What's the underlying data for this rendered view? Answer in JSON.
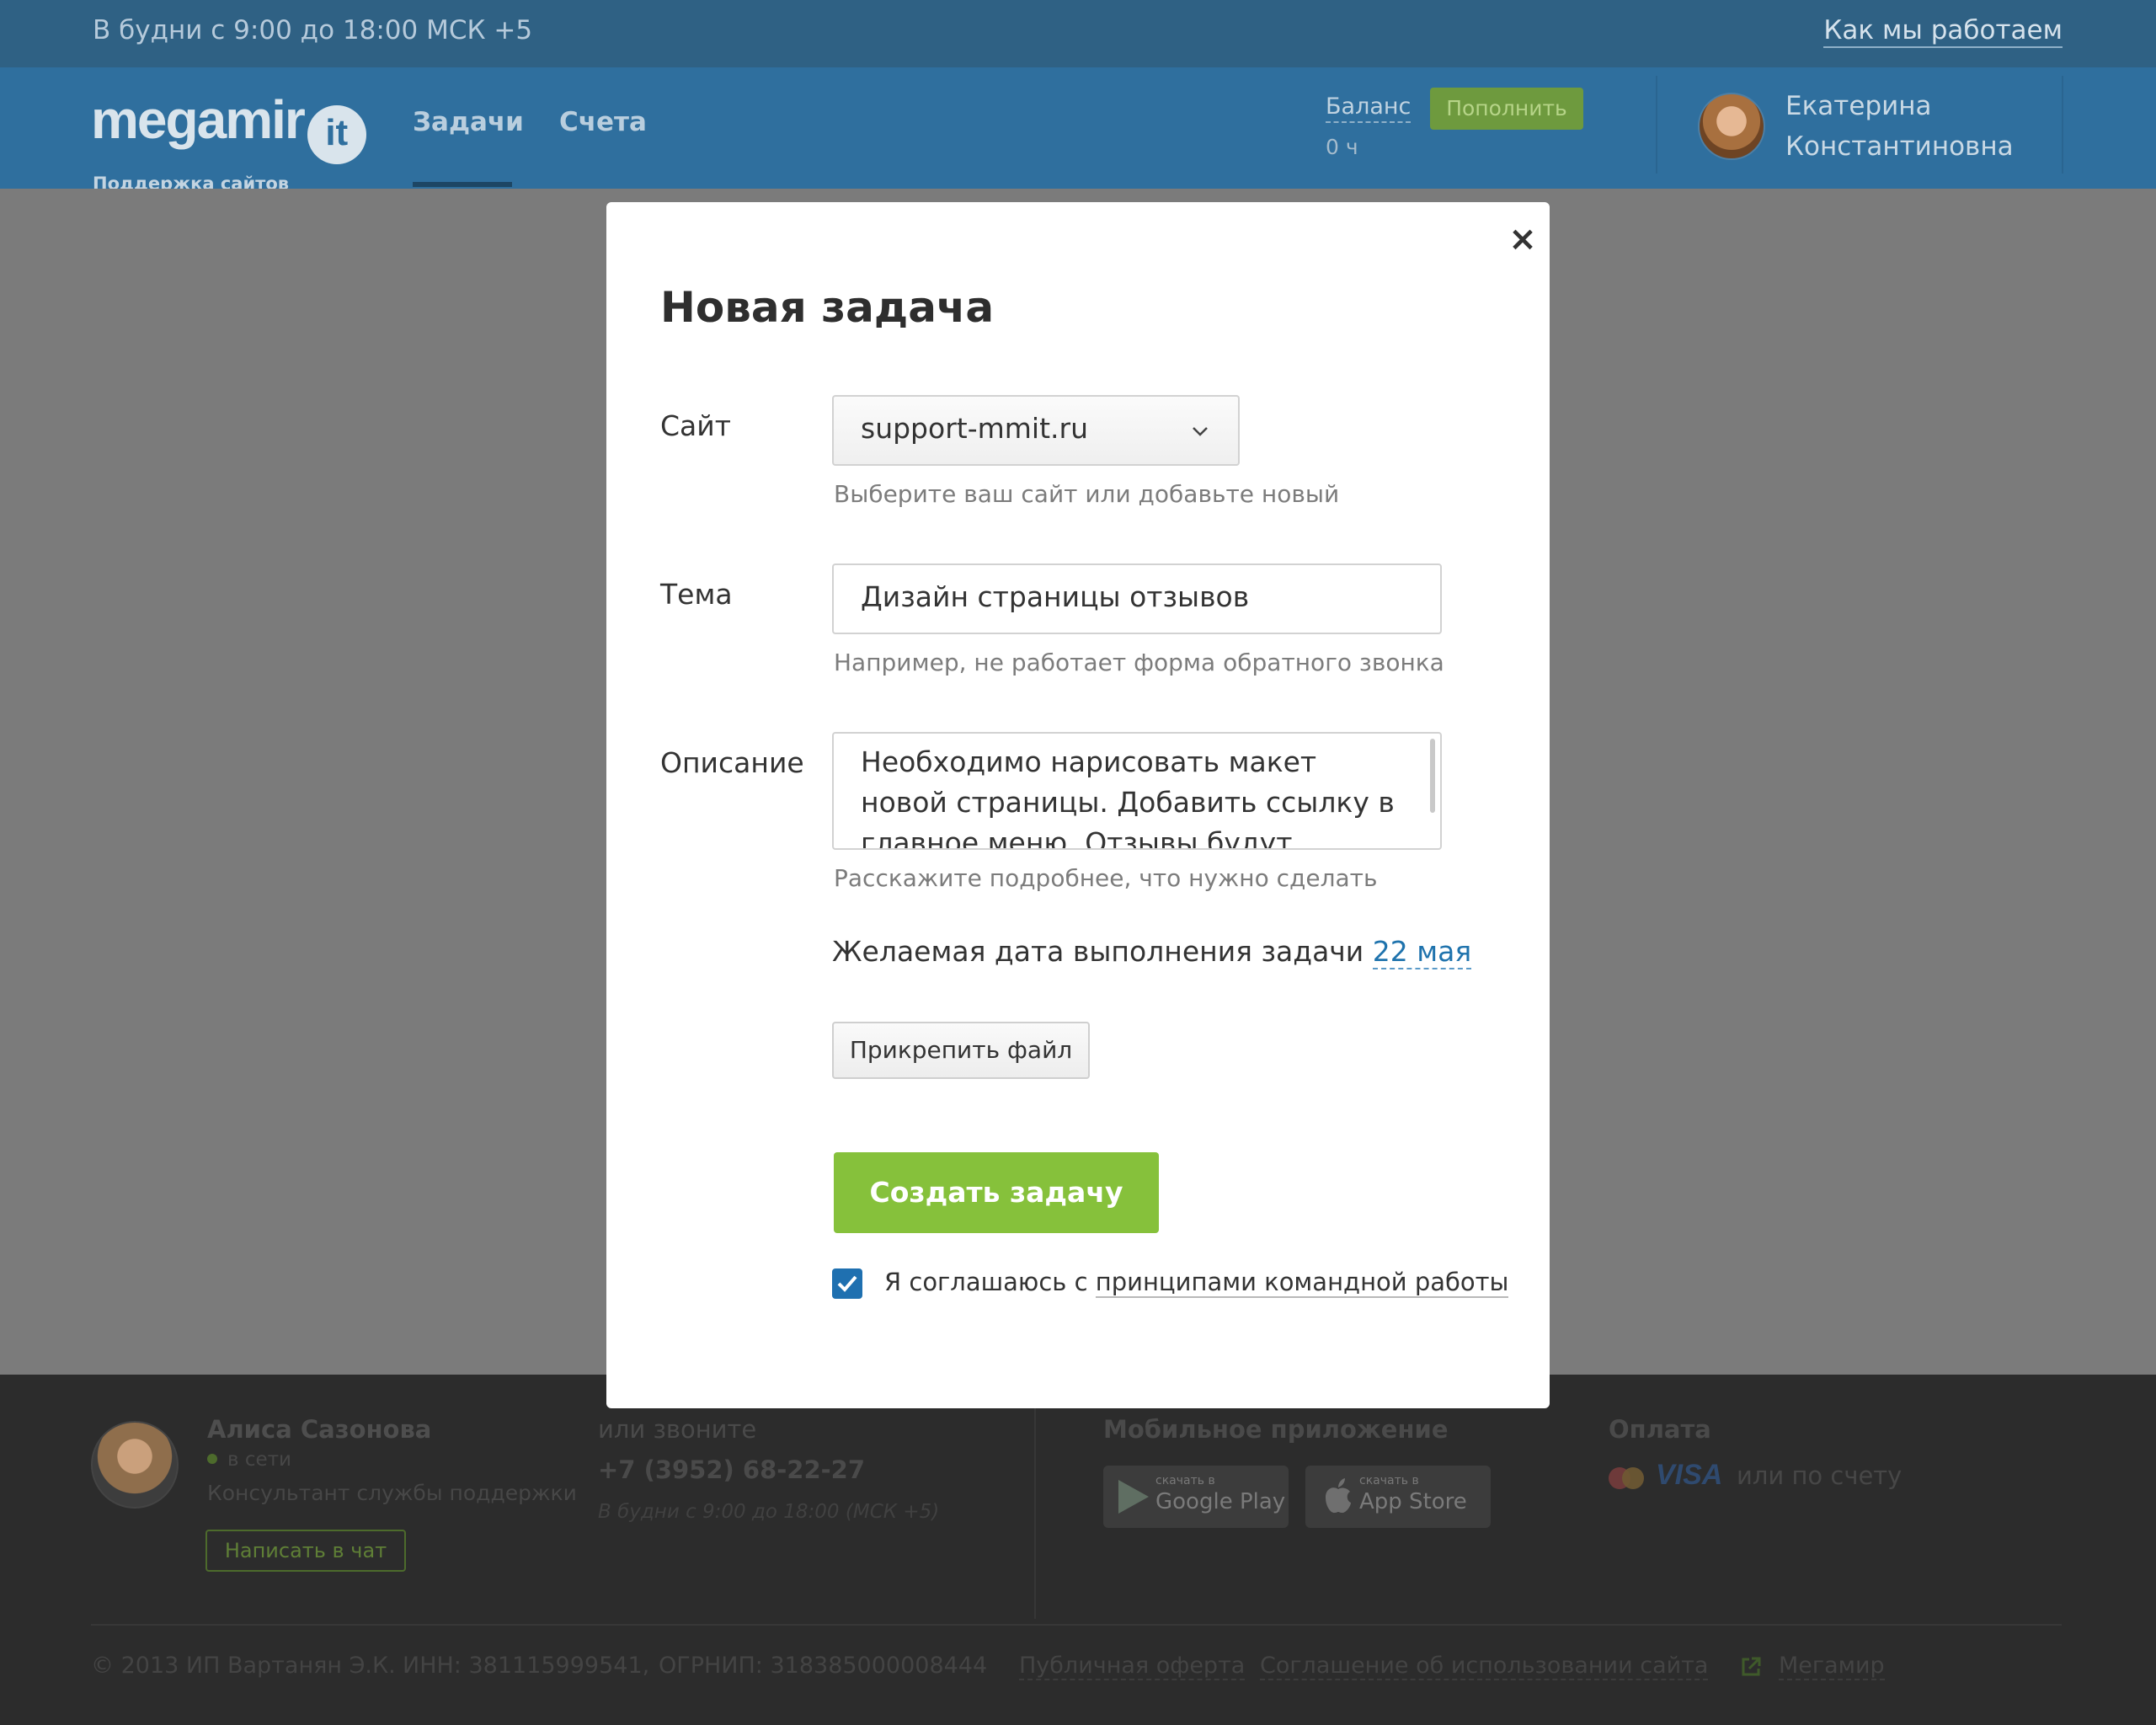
{
  "topbar": {
    "hours": "В будни с 9:00 до 18:00 МСК +5",
    "how_we_work": "Как мы работаем"
  },
  "header": {
    "logo_word": "megamir",
    "logo_it": "it",
    "logo_sub": "Поддержка сайтов",
    "nav": [
      {
        "label": "Задачи",
        "active": true
      },
      {
        "label": "Счета",
        "active": false
      }
    ],
    "balance_label": "Баланс",
    "topup_label": "Пополнить",
    "balance_value": "0 ч",
    "user_first_name": "Екатерина",
    "user_last_name": "Константиновна"
  },
  "modal": {
    "title": "Новая задача",
    "site": {
      "label": "Сайт",
      "value": "support-mmit.ru",
      "hint": "Выберите ваш сайт или добавьте новый"
    },
    "topic": {
      "label": "Тема",
      "value": "Дизайн страницы отзывов",
      "hint": "Например, не работает форма обратного звонка"
    },
    "description": {
      "label": "Описание",
      "value": "Необходимо нарисовать макет новой страницы. Добавить ссылку в главное меню. Отзывы будут подгружаться из",
      "hint": "Расскажите подробнее, что нужно сделать"
    },
    "due_label": "Желаемая дата выполнения задачи",
    "due_date": "22 мая",
    "attach_label": "Прикрепить файл",
    "create_label": "Создать задачу",
    "agree_checked": true,
    "agree_prefix": "Я соглашаюсь с",
    "agree_link": "принципами командной работы",
    "close_glyph": "×"
  },
  "footer": {
    "consultant_name": "Алиса Сазонова",
    "consultant_status": "в сети",
    "consultant_role": "Консультант службы поддержки",
    "chat_label": "Написать в чат",
    "or_call": "или звоните",
    "phone": "+7 (3952) 68-22-27",
    "phone_hours": "В будни с 9:00 до 18:00 (МСК +5)",
    "mobile_title": "Мобильное приложение",
    "google_small": "скачать в",
    "google_big": "Google Play",
    "appstore_small": "скачать в",
    "appstore_big": "App Store",
    "pay_title": "Оплата",
    "visa": "VISA",
    "or_bill": "или по счету",
    "copyright": "© 2013 ИП Вартанян Э.К.",
    "inn": "ИНН: 381115999541,",
    "ogrn": "ОГРНИП: 318385000008444",
    "offer": "Публичная оферта",
    "agreement": "Соглашение об использовании сайта",
    "megamir": "Мегамир"
  },
  "colors": {
    "header_blue": "#2f6f9e",
    "accent_green": "#86c13b",
    "link_blue": "#1f73ad",
    "overlay_gray": "#7b7b7b",
    "footer_dark": "#2c2c2c"
  }
}
